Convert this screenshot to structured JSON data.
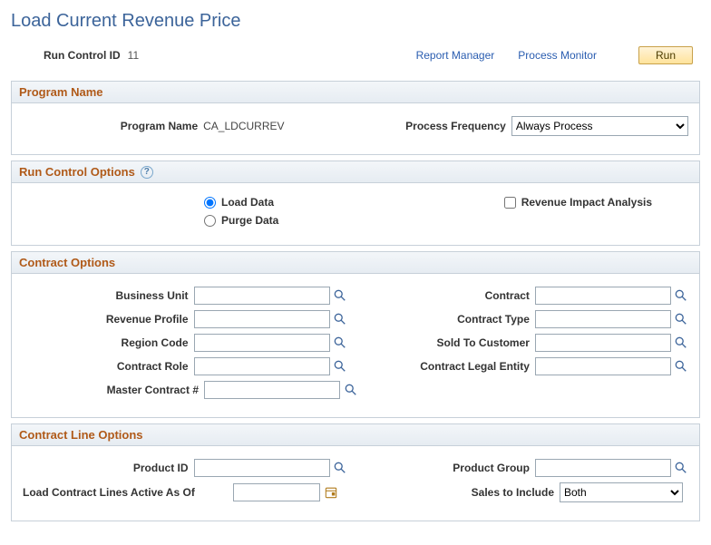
{
  "page_title": "Load Current Revenue Price",
  "top": {
    "run_control_label": "Run Control ID",
    "run_control_value": "11",
    "report_manager": "Report Manager",
    "process_monitor": "Process Monitor",
    "run_btn": "Run"
  },
  "program": {
    "section_title": "Program Name",
    "program_name_label": "Program Name",
    "program_name_value": "CA_LDCURREV",
    "process_freq_label": "Process Frequency",
    "process_freq_value": "Always Process"
  },
  "run_ctl": {
    "section_title": "Run Control Options",
    "load_data": "Load Data",
    "purge_data": "Purge Data",
    "rev_impact": "Revenue Impact Analysis"
  },
  "contract": {
    "section_title": "Contract Options",
    "business_unit": "Business Unit",
    "revenue_profile": "Revenue Profile",
    "region_code": "Region Code",
    "contract_role": "Contract Role",
    "master_contract": "Master Contract #",
    "contract": "Contract",
    "contract_type": "Contract Type",
    "sold_to_customer": "Sold To Customer",
    "contract_legal_entity": "Contract Legal Entity"
  },
  "line": {
    "section_title": "Contract Line Options",
    "product_id": "Product ID",
    "product_group": "Product Group",
    "active_as_of": "Load Contract Lines Active As Of",
    "sales_to_include": "Sales to Include",
    "sales_value": "Both"
  }
}
